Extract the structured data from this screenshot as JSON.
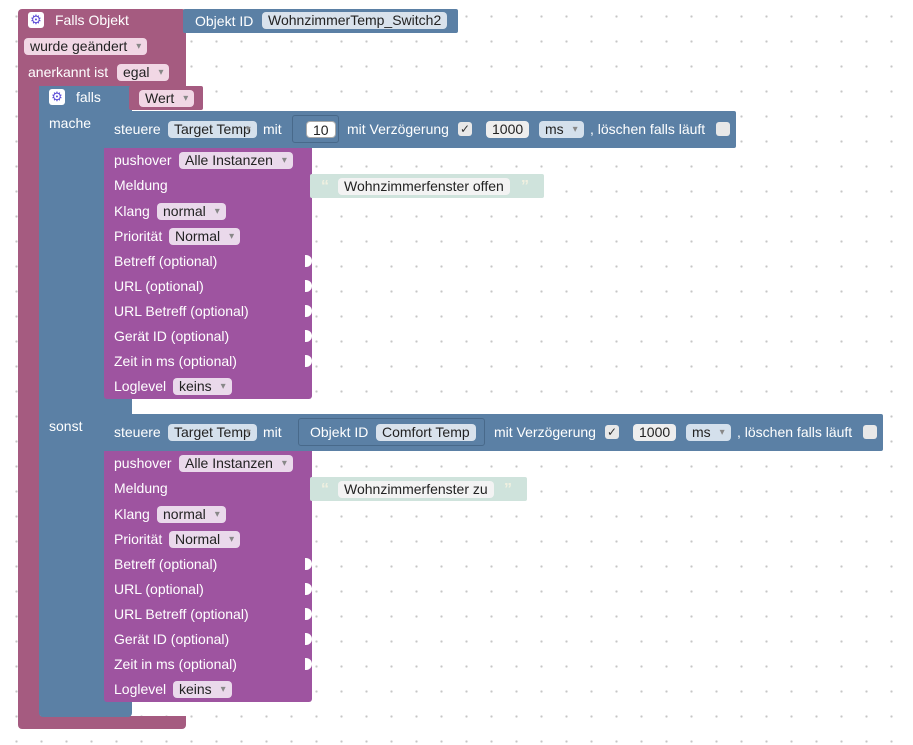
{
  "trigger": {
    "title": "Falls Objekt",
    "object_label": "Objekt ID",
    "object_id": "WohnzimmerTemp_Switch2",
    "changed": "wurde geändert",
    "ack_label": "anerkannt ist",
    "ack_value": "egal"
  },
  "ifblock": {
    "falls": "falls",
    "mache": "mache",
    "sonst": "sonst",
    "condition": "Wert"
  },
  "control1": {
    "steuere": "steuere",
    "target": "Target Temp",
    "mit": "mit",
    "value": "10",
    "delay_label": "mit Verzögerung",
    "delay_check": "✓",
    "delay_value": "1000",
    "unit": "ms",
    "clear_label": ", löschen falls läuft"
  },
  "pushover1": {
    "title": "pushover",
    "instance": "Alle Instanzen",
    "message_label": "Meldung",
    "message": "Wohnzimmerfenster offen",
    "sound_label": "Klang",
    "sound": "normal",
    "priority_label": "Priorität",
    "priority": "Normal",
    "subject": "Betreff (optional)",
    "url": "URL (optional)",
    "url_subject": "URL Betreff (optional)",
    "device": "Gerät ID (optional)",
    "time": "Zeit in ms (optional)",
    "loglevel_label": "Loglevel",
    "loglevel": "keins"
  },
  "control2": {
    "steuere": "steuere",
    "target": "Target Temp",
    "mit": "mit",
    "object_label": "Objekt ID",
    "object_id": "Comfort Temp",
    "delay_label": "mit Verzögerung",
    "delay_check": "✓",
    "delay_value": "1000",
    "unit": "ms",
    "clear_label": ", löschen falls läuft"
  },
  "pushover2": {
    "title": "pushover",
    "instance": "Alle Instanzen",
    "message_label": "Meldung",
    "message": "Wohnzimmerfenster zu",
    "sound_label": "Klang",
    "sound": "normal",
    "priority_label": "Priorität",
    "priority": "Normal",
    "subject": "Betreff (optional)",
    "url": "URL (optional)",
    "url_subject": "URL Betreff (optional)",
    "device": "Gerät ID (optional)",
    "time": "Zeit in ms (optional)",
    "loglevel_label": "Loglevel",
    "loglevel": "keins"
  },
  "quote_open": "“",
  "quote_close": "”",
  "gear_glyph": "⚙",
  "colors": {
    "trigger_block": "#a55b80",
    "logic_block": "#5b80a5",
    "pushover_block": "#9e54a0",
    "text_block": "#cfe3dc"
  },
  "icons": [
    "gear-icon",
    "checkbox-icon",
    "dropdown-arrow-icon",
    "quote-icon"
  ]
}
